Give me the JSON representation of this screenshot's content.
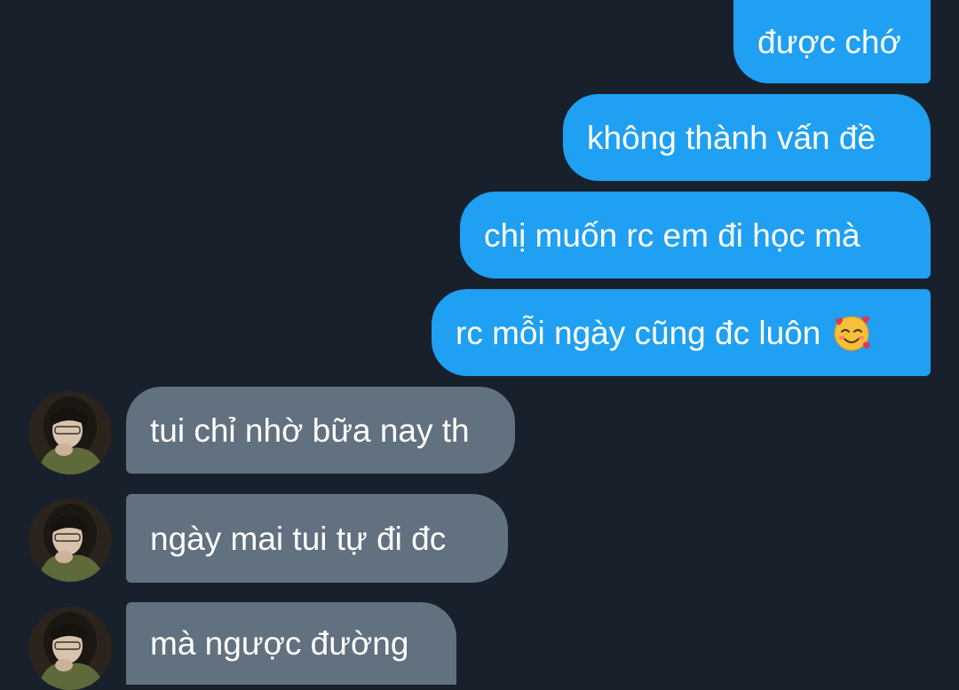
{
  "conversation": {
    "sent": [
      {
        "text": "được chớ"
      },
      {
        "text": "không thành vấn đề"
      },
      {
        "text": "chị muốn rc em đi học mà"
      },
      {
        "text": "rc mỗi ngày cũng đc luôn",
        "emoji": "smiling-face-with-hearts-icon"
      }
    ],
    "received": [
      {
        "text": "tui chỉ nhờ bữa nay th"
      },
      {
        "text": "ngày mai tui tự đi đc"
      },
      {
        "text": "mà ngược đường"
      }
    ]
  },
  "colors": {
    "background": "#18202b",
    "sent_bubble": "#1fa0f2",
    "received_bubble": "#627180",
    "text": "#ffffff"
  }
}
